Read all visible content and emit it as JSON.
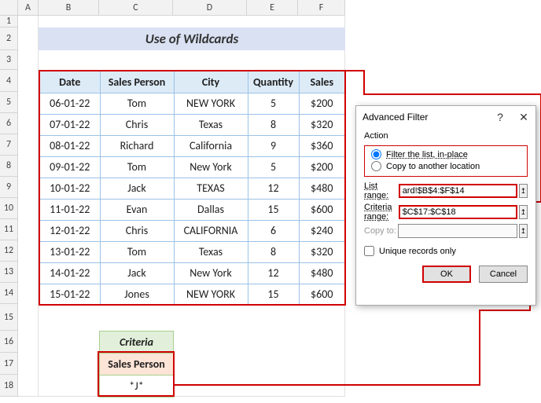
{
  "title": "Use of Wildcards",
  "columns": {
    "date": "Date",
    "person": "Sales Person",
    "city": "City",
    "qty": "Quantity",
    "sales": "Sales"
  },
  "rows": [
    {
      "date": "06-01-22",
      "person": "Tom",
      "city": "NEW YORK",
      "qty": "5",
      "sales": "$200"
    },
    {
      "date": "07-01-22",
      "person": "Chris",
      "city": "Texas",
      "qty": "8",
      "sales": "$320"
    },
    {
      "date": "08-01-22",
      "person": "Richard",
      "city": "California",
      "qty": "9",
      "sales": "$360"
    },
    {
      "date": "09-01-22",
      "person": "Tom",
      "city": "New York",
      "qty": "5",
      "sales": "$200"
    },
    {
      "date": "10-01-22",
      "person": "Jack",
      "city": "TEXAS",
      "qty": "12",
      "sales": "$480"
    },
    {
      "date": "11-01-22",
      "person": "Evan",
      "city": "Dallas",
      "qty": "15",
      "sales": "$600"
    },
    {
      "date": "12-01-22",
      "person": "Chris",
      "city": "CALIFORNIA",
      "qty": "6",
      "sales": "$240"
    },
    {
      "date": "13-01-22",
      "person": "Tom",
      "city": "Texas",
      "qty": "8",
      "sales": "$320"
    },
    {
      "date": "14-01-22",
      "person": "Jack",
      "city": "New York",
      "qty": "12",
      "sales": "$480"
    },
    {
      "date": "15-01-22",
      "person": "Jones",
      "city": "NEW YORK",
      "qty": "15",
      "sales": "$600"
    }
  ],
  "criteria": {
    "title": "Criteria",
    "header": "Sales Person",
    "value": "*J*"
  },
  "dialog": {
    "title": "Advanced Filter",
    "action_label": "Action",
    "radio_filter": "Filter the list, in-place",
    "radio_copy": "Copy to another location",
    "list_range_label": "List range:",
    "list_range": "ard!$B$4:$F$14",
    "criteria_range_label": "Criteria range:",
    "criteria_range": "$C$17:$C$18",
    "copy_to_label": "Copy to:",
    "copy_to": "",
    "unique_label": "Unique records only",
    "ok": "OK",
    "cancel": "Cancel"
  },
  "col_headers": [
    "A",
    "B",
    "C",
    "D",
    "E",
    "F"
  ],
  "row_headers": [
    "1",
    "2",
    "3",
    "4",
    "5",
    "6",
    "7",
    "8",
    "9",
    "10",
    "11",
    "12",
    "13",
    "14",
    "15",
    "16",
    "17",
    "18"
  ]
}
